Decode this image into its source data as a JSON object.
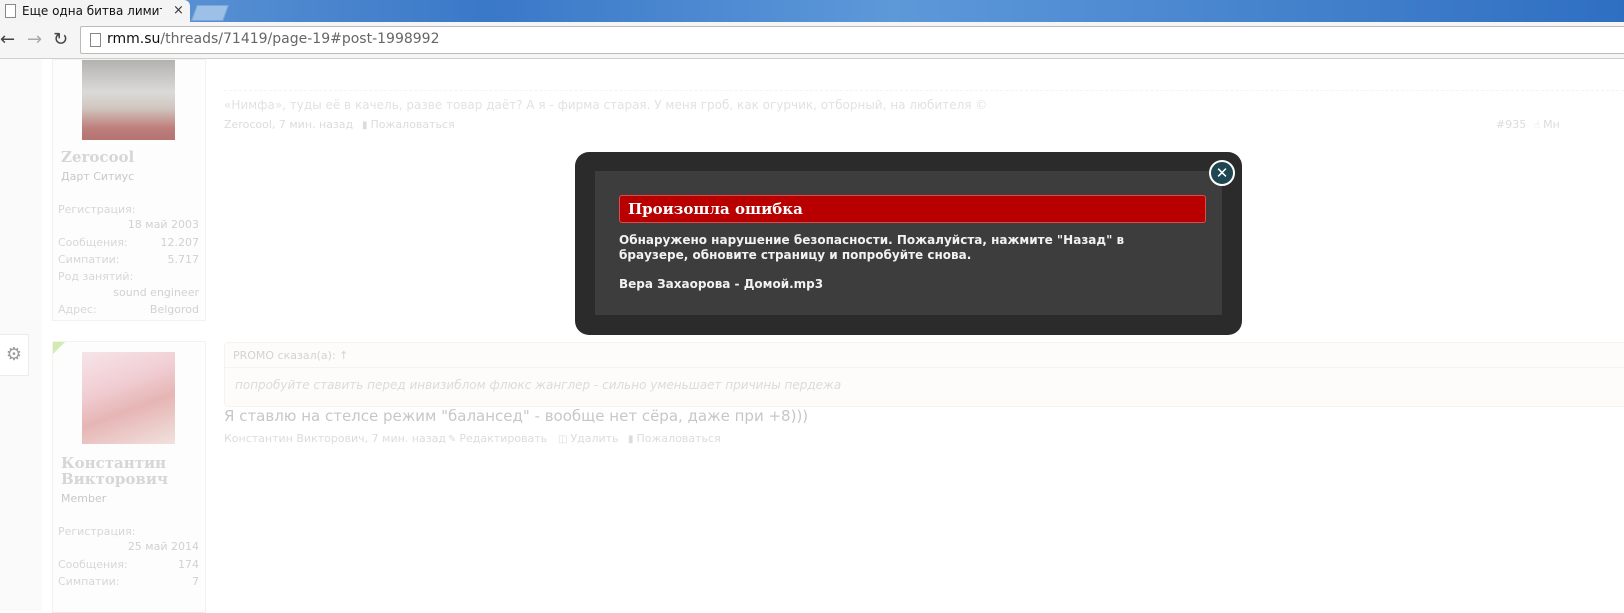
{
  "browser": {
    "tab_title": "Еще одна битва лимитер",
    "tab_close": "×",
    "url_host": "rmm.su",
    "url_path": "/threads/71419/page-19#post-1998992"
  },
  "post1": {
    "signature": "«Нимфа», туды её в качель, разве товар даёт? А я - фирма старая. У меня гроб, как огурчик, отборный, на любителя ©",
    "meta": "Zerocool, 7 мин. назад",
    "report": "Пожаловаться",
    "post_number": "#935",
    "like": "Мн"
  },
  "user1": {
    "name": "Zerocool",
    "title": "Дарт Ситиус",
    "reg_label": "Регистрация:",
    "reg_value": "18 май 2003",
    "msgs_label": "Сообщения:",
    "msgs_value": "12.207",
    "likes_label": "Симпатии:",
    "likes_value": "5.717",
    "occ_label": "Род занятий:",
    "occ_value": "sound engineer",
    "addr_label": "Адрес:",
    "addr_value": "Belgorod"
  },
  "user2": {
    "name": "Константин Викторович",
    "title": "Member",
    "reg_label": "Регистрация:",
    "reg_value": "25 май 2014",
    "msgs_label": "Сообщения:",
    "msgs_value": "174",
    "likes_label": "Симпатии:",
    "likes_value": "7"
  },
  "post2": {
    "quote_author": "PROMO сказал(а): ↑",
    "quote_text": "попробуйте ставить перед инвизиблом флюкс жанглер - сильно уменьшает причины пердежа",
    "text": "Я ставлю на стелсе режим \"балансед\" - вообще нет сёра, даже при +8)))",
    "meta": "Константин Викторович, 7 мин. назад",
    "edit": "Редактировать",
    "delete": "Удалить",
    "report": "Пожаловаться"
  },
  "modal": {
    "heading": "Произошла ошибка",
    "message": "Обнаружено нарушение безопасности. Пожалуйста, нажмите \"Назад\" в браузере, обновите страницу и попробуйте снова.",
    "extra": "Вера Захаорова - Домой.mp3",
    "close": "✕"
  }
}
